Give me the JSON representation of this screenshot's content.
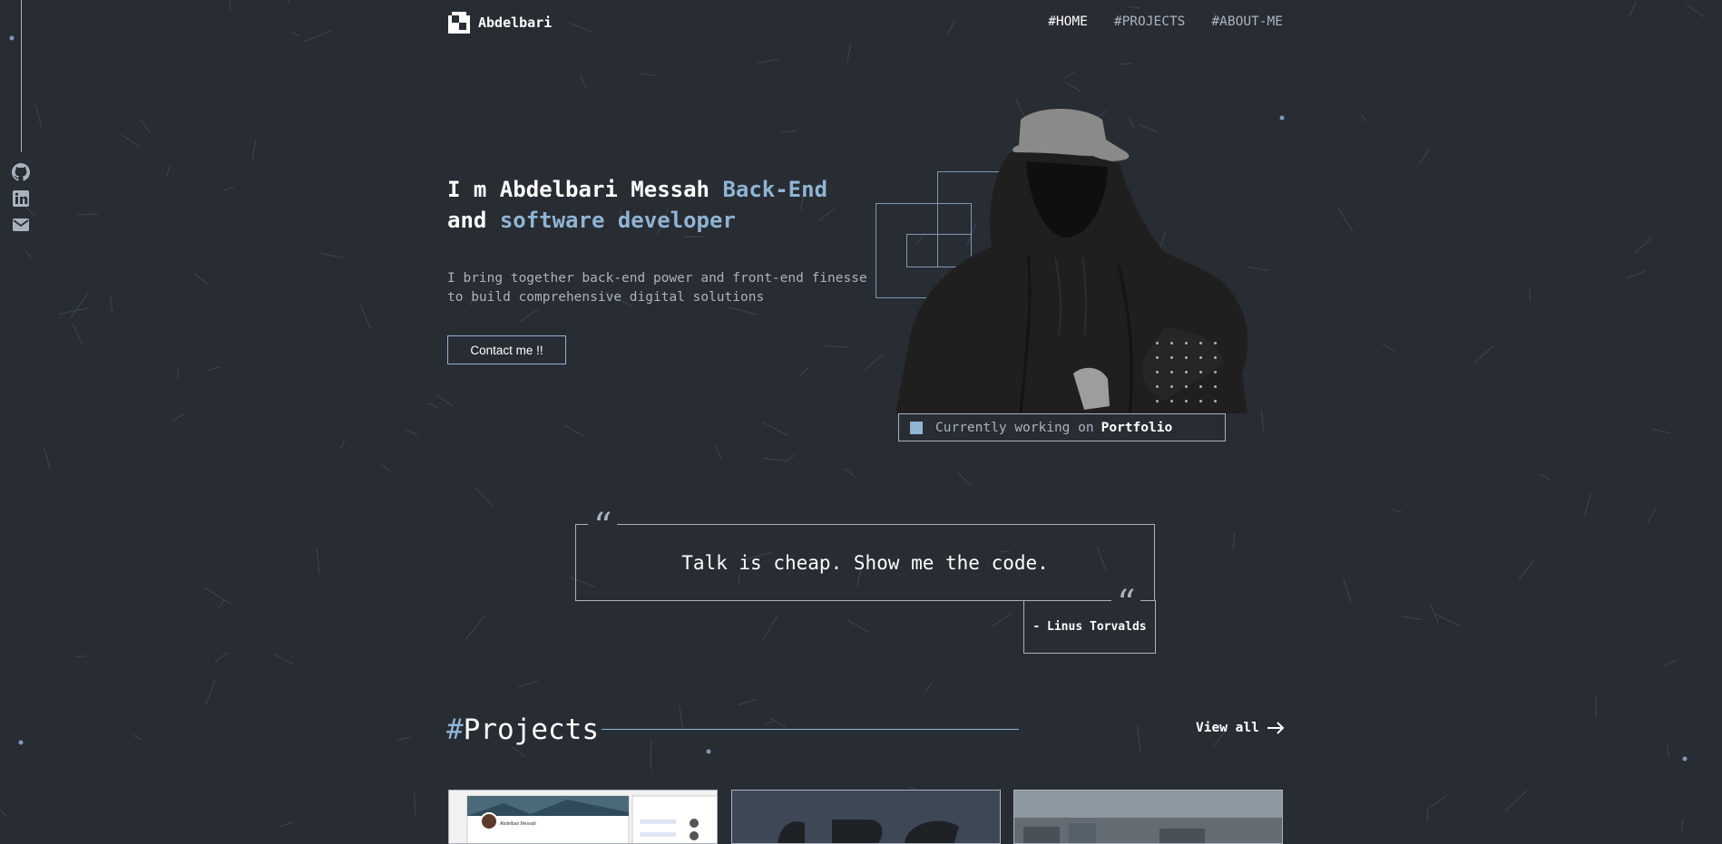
{
  "header": {
    "logo_text": "Abdelbari",
    "nav": [
      {
        "hash": "#",
        "label": "HOME"
      },
      {
        "hash": "#",
        "label": "PROJECTS"
      },
      {
        "hash": "#",
        "label": "ABOUT-ME"
      }
    ]
  },
  "social": {
    "icons": [
      "github-icon",
      "linkedin-icon",
      "email-icon"
    ]
  },
  "hero": {
    "title_line1_white": "I m Abdelbari Messah",
    "title_line1_accent": "Back-End",
    "title_line2_white": "and",
    "title_line2_accent": "software developer",
    "subtitle": "I bring together back-end power and front-end finesse to build comprehensive digital solutions",
    "contact_button": "Contact me !!",
    "status_prefix": "Currently working on",
    "status_project": "Portfolio"
  },
  "quote": {
    "text": "Talk is cheap. Show me the code.",
    "author": "- Linus Torvalds"
  },
  "projects": {
    "hash": "#",
    "title": "Projects",
    "view_all": "View all",
    "card_snippet_name": "Abdelbari Messah"
  },
  "colors": {
    "background": "#282c33",
    "accent": "#90b4d3",
    "gray": "#abb2bf"
  }
}
